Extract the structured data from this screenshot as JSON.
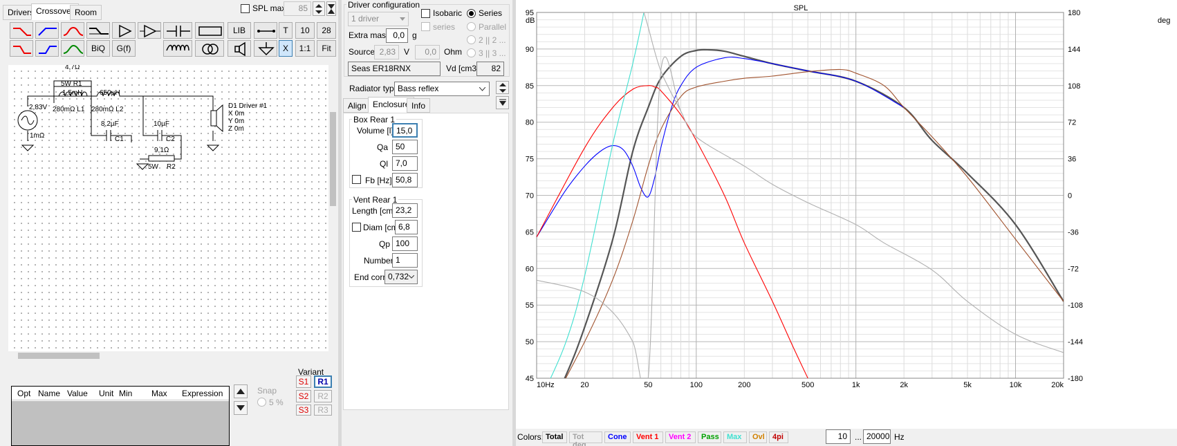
{
  "tabs": {
    "drivers": "Drivers",
    "crossover": "Crossover",
    "room": "Room"
  },
  "spl_max": {
    "label": "SPL max",
    "value": "85"
  },
  "toolbar": {
    "lib": "LIB",
    "t": "T",
    "n10": "10",
    "n28": "28",
    "biq": "BiQ",
    "gf": "G(f)",
    "x": "X",
    "one_one": "1:1",
    "fit": "Fit"
  },
  "schematic": {
    "r1_value": "4,7Ω",
    "r1_label": "5W   R1",
    "l1_value": "1,5mH",
    "l1_label": "280mΩ L1",
    "l2_value": "650µH",
    "l2_label": "280mΩ L2",
    "c1_value": "8,2µF",
    "c1_label": "C1",
    "c2_value": "10µF",
    "c2_label": "C2",
    "r2_value": "9,1Ω",
    "r2_label": "R2",
    "r2_power": "5W",
    "source_voltage": "2,83V",
    "source_res": "1mΩ",
    "driver_label": "D1 Driver #1",
    "driver_x": "X 0m",
    "driver_y": "Y 0m",
    "driver_z": "Z 0m"
  },
  "params_table": {
    "headers": [
      "Opt",
      "Name",
      "Value",
      "Unit",
      "Min",
      "Max",
      "Expression"
    ]
  },
  "snap": {
    "label": "Snap",
    "value": "5 %"
  },
  "variant": {
    "label": "Variant",
    "buttons": [
      "S1",
      "R1",
      "S2",
      "R2",
      "S3",
      "R3"
    ]
  },
  "driver_config": {
    "title": "Driver configuration",
    "drivers_select": "1 driver",
    "isobaric": "Isobaric",
    "series_chk": "series",
    "series": "Series",
    "parallel": "Parallel",
    "opt2": "2 || 2 ...",
    "opt3": "3 || 3 ...",
    "extra_mass_label": "Extra mass",
    "extra_mass": "0,0",
    "extra_mass_unit": "g",
    "source_label": "Source",
    "source_v": "2,83",
    "source_v_unit": "V",
    "source_ohm": "0,0",
    "source_ohm_unit": "Ohm",
    "driver_name": "Seas ER18RNX",
    "vd_label": "Vd [cm3]",
    "vd": "82"
  },
  "radiator": {
    "label": "Radiator type",
    "value": "Bass reflex"
  },
  "subtabs": {
    "align": "Align",
    "enclosure": "Enclosure",
    "info": "Info"
  },
  "box": {
    "title": "Box Rear 1",
    "volume_label": "Volume [l]",
    "volume": "15,0",
    "qa_label": "Qa",
    "qa": "50",
    "ql_label": "Ql",
    "ql": "7,0",
    "fb_label": "Fb [Hz]",
    "fb": "50,8"
  },
  "vent": {
    "title": "Vent Rear 1",
    "length_label": "Length [cm]",
    "length": "23,2",
    "diam_label": "Diam [cm]",
    "diam": "6,8",
    "qp_label": "Qp",
    "qp": "100",
    "number_label": "Number",
    "number": "1",
    "endcorr_label": "End corr",
    "endcorr": "0,732"
  },
  "colors_bar": {
    "label": "Colors:",
    "items": [
      "Total",
      "Tot deg",
      "Cone",
      "Vent 1",
      "Vent 2",
      "Pass",
      "Max",
      "Ovl",
      "4pi"
    ],
    "item_colors": [
      "#000000",
      "#a0a0a0",
      "#0000ff",
      "#ff0000",
      "#ff00ff",
      "#00a000",
      "#40e0d0",
      "#d08000",
      "#c00000"
    ],
    "fmin": "10",
    "dots": "...",
    "fmax": "20000",
    "unit": "Hz"
  },
  "chart_data": {
    "type": "line",
    "title": "SPL",
    "xlabel": "",
    "ylabel": "dB",
    "y2label": "deg",
    "xscale": "log",
    "xlim": [
      10,
      20000
    ],
    "ylim": [
      45,
      95
    ],
    "y2lim": [
      -180,
      180
    ],
    "x_ticks": [
      10,
      20,
      50,
      100,
      200,
      500,
      1000,
      2000,
      5000,
      10000,
      20000
    ],
    "x_tick_labels": [
      "10Hz",
      "20",
      "50",
      "100",
      "200",
      "500",
      "1k",
      "2k",
      "5k",
      "10k",
      "20k"
    ],
    "y_ticks": [
      95,
      90,
      85,
      80,
      75,
      70,
      65,
      60,
      55,
      50,
      45
    ],
    "y2_ticks": [
      180,
      144,
      108,
      72,
      36,
      0,
      -36,
      -72,
      -108,
      -144,
      -180
    ],
    "grid": true,
    "series": [
      {
        "name": "Total",
        "color": "#555555",
        "x": [
          10,
          15,
          20,
          30,
          40,
          50,
          60,
          80,
          100,
          120,
          150,
          200,
          300,
          500,
          1000,
          2000,
          3000,
          5000,
          10000,
          20000
        ],
        "y": [
          37,
          45,
          52,
          64,
          76,
          82,
          86,
          89,
          89.8,
          89.9,
          89.7,
          89.0,
          88.0,
          87.0,
          85.6,
          82.0,
          77.5,
          73.0,
          66.0,
          55.5
        ]
      },
      {
        "name": "Cone",
        "color": "#0000ff",
        "x": [
          10,
          15,
          20,
          25,
          30,
          35,
          40,
          45,
          50,
          55,
          60,
          70,
          80,
          100,
          150,
          200,
          300,
          500,
          1000,
          2000
        ],
        "y": [
          64.3,
          70.5,
          74.0,
          76.0,
          76.8,
          76.2,
          74.0,
          71.0,
          69.8,
          72.5,
          76.5,
          82.0,
          85.0,
          87.5,
          88.8,
          88.7,
          88.0,
          87.0,
          85.6,
          82.0
        ]
      },
      {
        "name": "Vent 1",
        "color": "#ff0000",
        "x": [
          10,
          20,
          30,
          40,
          50,
          55,
          60,
          80,
          100,
          150,
          200,
          300,
          400,
          500
        ],
        "y": [
          64.3,
          76.5,
          82.0,
          84.5,
          85.0,
          84.8,
          84.3,
          81.0,
          77.5,
          70.0,
          63.5,
          55.5,
          49.5,
          45.0
        ]
      },
      {
        "name": "Ovl",
        "color": "#a0522d",
        "x": [
          10,
          20,
          30,
          40,
          50,
          60,
          80,
          100,
          150,
          200,
          300,
          500,
          800,
          1000,
          1500,
          2000,
          3000,
          5000,
          10000,
          20000
        ],
        "y": [
          37.5,
          50.0,
          58.5,
          66.5,
          74.0,
          79.0,
          83.5,
          84.8,
          85.6,
          86.0,
          86.3,
          86.9,
          87.2,
          86.7,
          85.0,
          82.0,
          78.0,
          72.5,
          64.0,
          55.5
        ]
      },
      {
        "name": "Max",
        "color": "#40e0d0",
        "x": [
          10,
          15,
          20,
          30,
          40,
          47
        ],
        "y": [
          41,
          49.5,
          59,
          77,
          88,
          95
        ]
      },
      {
        "name": "Tot deg",
        "color": "#b0b0b0",
        "x": [
          10,
          20,
          30,
          40,
          50,
          60,
          80,
          100,
          200,
          300,
          500,
          1000,
          1500,
          3000,
          5000,
          10000,
          20000
        ],
        "y": [
          58.4,
          56.8,
          54.0,
          50.0,
          45.0,
          87.0,
          81.5,
          78.0,
          74.0,
          71.5,
          69.0,
          66.0,
          63.5,
          59.8,
          55.5,
          51.0,
          48.5
        ]
      },
      {
        "name": "Tot deg",
        "color": "#b0b0b0",
        "x": [
          47,
          50,
          60,
          80
        ],
        "y": [
          95,
          93,
          87,
          81.5
        ]
      }
    ]
  }
}
